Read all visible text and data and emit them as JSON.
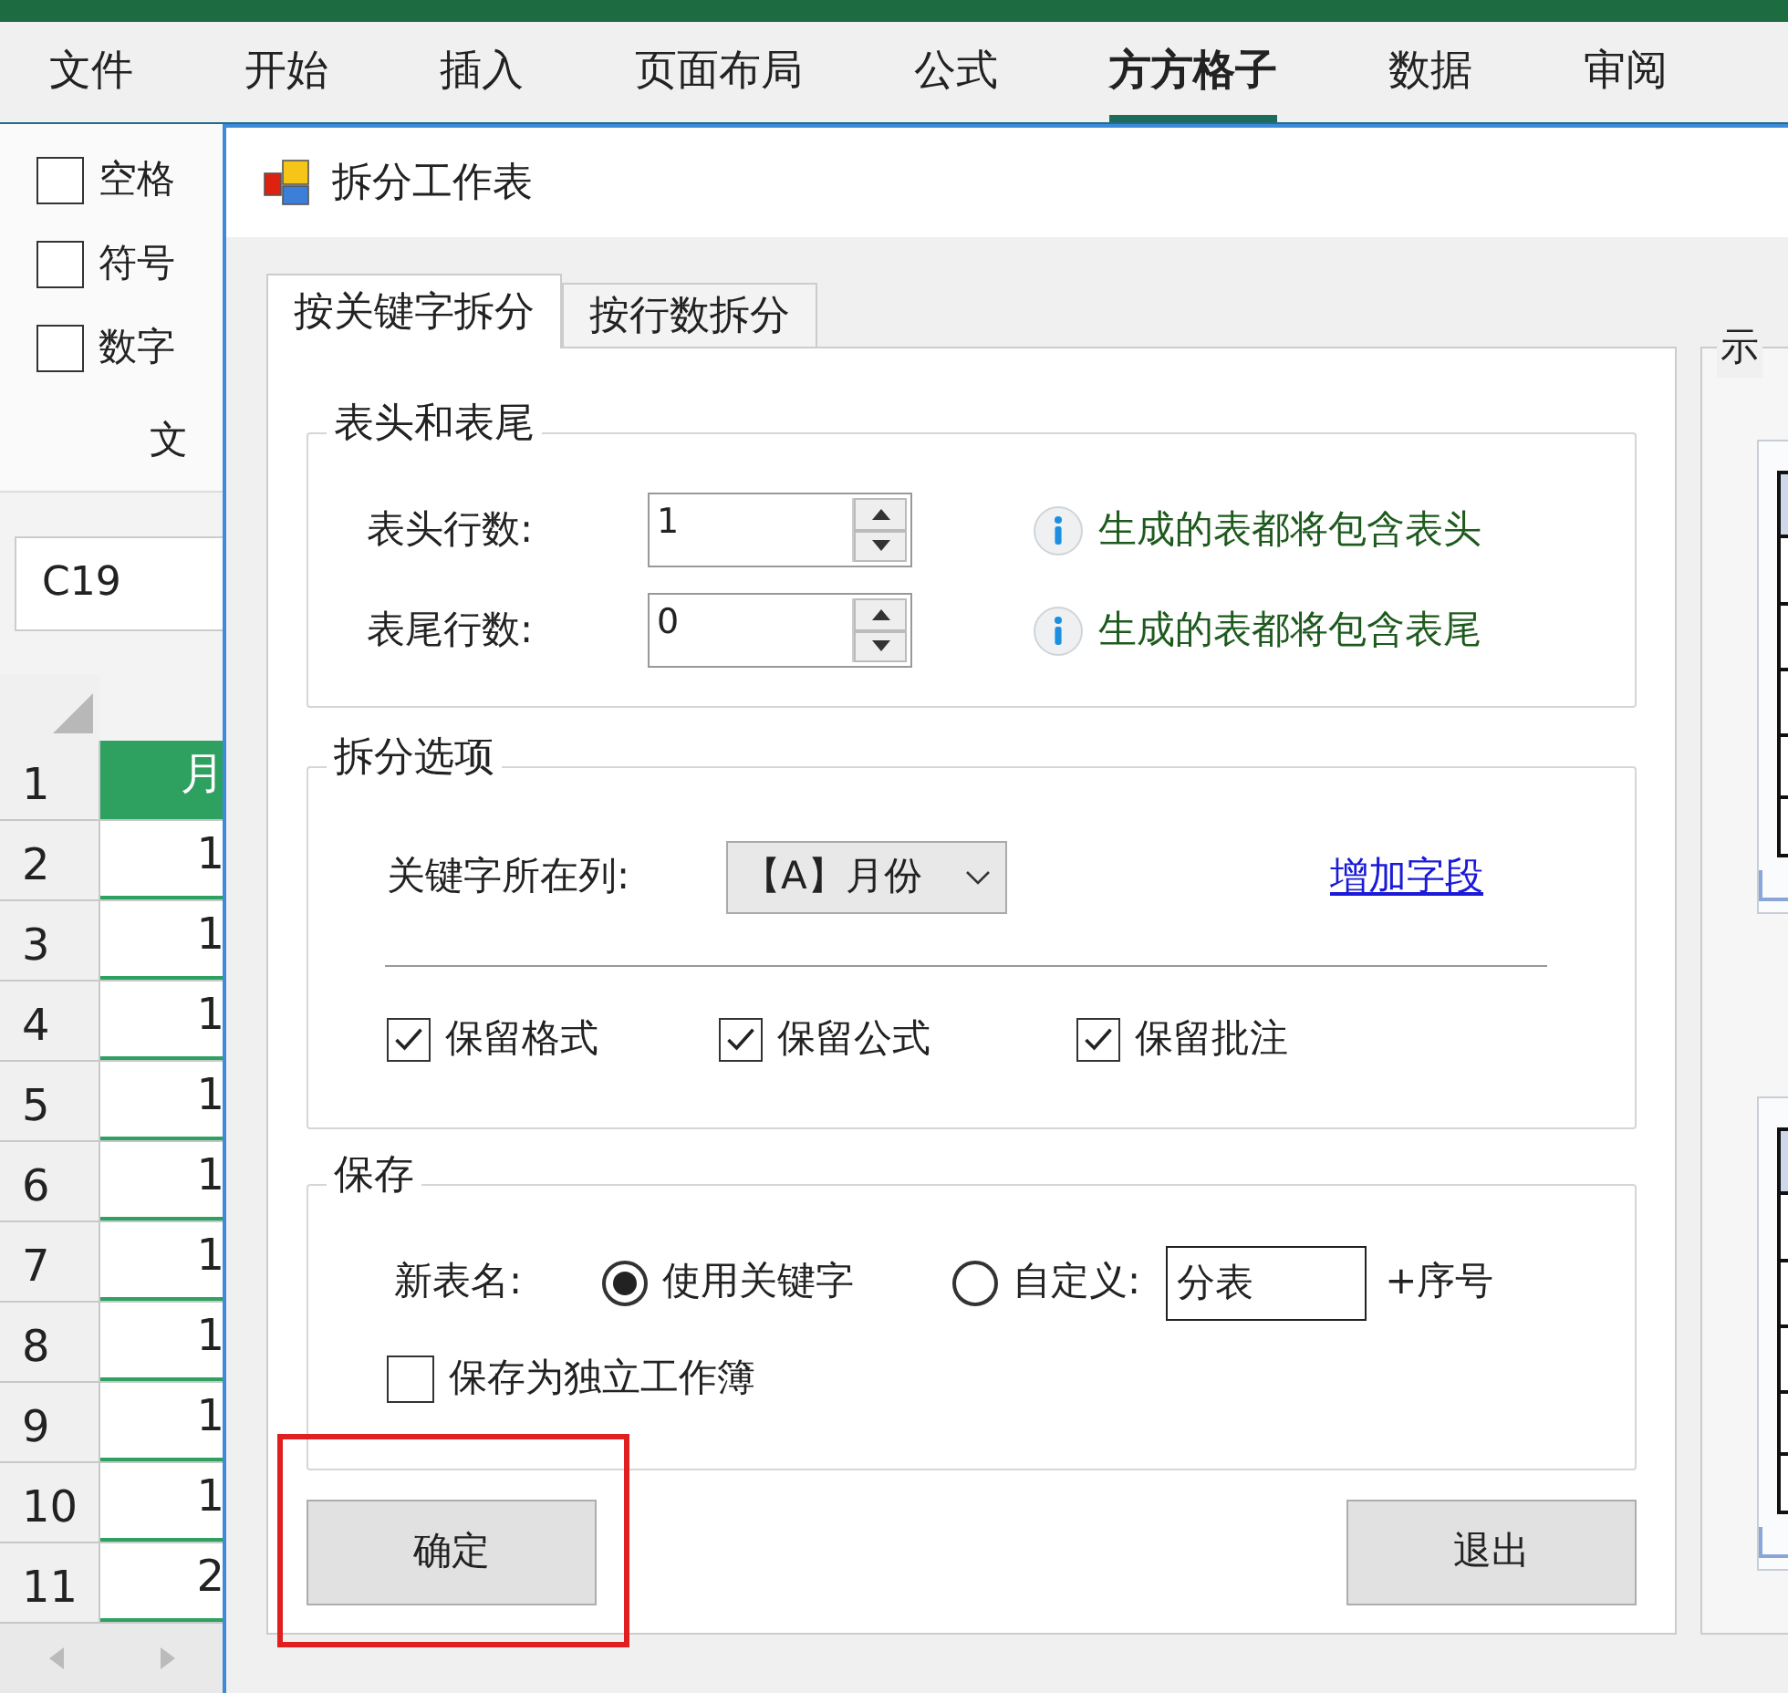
{
  "ribbon": {
    "tabs": [
      {
        "label": "文件",
        "selected": false
      },
      {
        "label": "开始",
        "selected": false
      },
      {
        "label": "插入",
        "selected": false
      },
      {
        "label": "页面布局",
        "selected": false
      },
      {
        "label": "公式",
        "selected": false
      },
      {
        "label": "方方格子",
        "selected": true
      },
      {
        "label": "数据",
        "selected": false
      },
      {
        "label": "审阅",
        "selected": false
      }
    ],
    "checkboxes": [
      {
        "label": "空格",
        "checked": false
      },
      {
        "label": "符号",
        "checked": false
      },
      {
        "label": "数字",
        "checked": false
      }
    ],
    "group_label": "文"
  },
  "sheet": {
    "name_box": "C19",
    "rows": [
      {
        "number": "1",
        "value": "月",
        "kind": "header"
      },
      {
        "number": "2",
        "value": "1",
        "kind": "data"
      },
      {
        "number": "3",
        "value": "1",
        "kind": "data"
      },
      {
        "number": "4",
        "value": "1",
        "kind": "data"
      },
      {
        "number": "5",
        "value": "1",
        "kind": "data"
      },
      {
        "number": "6",
        "value": "1",
        "kind": "data"
      },
      {
        "number": "7",
        "value": "1",
        "kind": "data"
      },
      {
        "number": "8",
        "value": "1",
        "kind": "data"
      },
      {
        "number": "9",
        "value": "1",
        "kind": "data"
      },
      {
        "number": "10",
        "value": "1",
        "kind": "data"
      },
      {
        "number": "11",
        "value": "2",
        "kind": "data"
      }
    ]
  },
  "dialog": {
    "title": "拆分工作表",
    "tabs": [
      {
        "label": "按关键字拆分",
        "selected": true
      },
      {
        "label": "按行数拆分",
        "selected": false
      }
    ],
    "header_footer": {
      "title": "表头和表尾",
      "rows": [
        {
          "label": "表头行数:",
          "value": "1",
          "hint": "生成的表都将包含表头"
        },
        {
          "label": "表尾行数:",
          "value": "0",
          "hint": "生成的表都将包含表尾"
        }
      ]
    },
    "split_options": {
      "title": "拆分选项",
      "column_label": "关键字所在列:",
      "column_value": "【A】月份",
      "link": "增加字段",
      "checkboxes": [
        {
          "label": "保留格式",
          "checked": true
        },
        {
          "label": "保留公式",
          "checked": true
        },
        {
          "label": "保留批注",
          "checked": true
        }
      ]
    },
    "save": {
      "title": "保存",
      "name_label": "新表名:",
      "radios": [
        {
          "label": "使用关键字",
          "selected": true
        },
        {
          "label": "自定义:",
          "selected": false
        }
      ],
      "custom_value": "分表",
      "suffix": "+序号",
      "separate_workbook": {
        "label": "保存为独立工作簿",
        "checked": false
      }
    },
    "buttons": [
      {
        "label": "确定",
        "highlighted": true
      },
      {
        "label": "退出",
        "highlighted": false
      }
    ],
    "preview_title": "示"
  }
}
